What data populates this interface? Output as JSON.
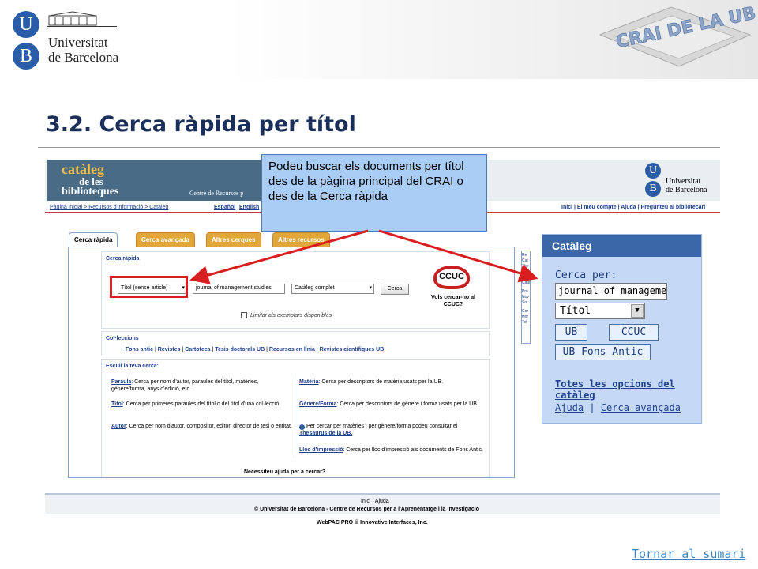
{
  "header": {
    "ub_letter_u": "U",
    "ub_letter_b": "B",
    "ub_name_line1": "Universitat",
    "ub_name_line2": "de Barcelona",
    "crai_logo_text": "CRAI DE LA UB"
  },
  "slide": {
    "title": "3.2. Cerca ràpida per títol",
    "back_link": "Tornar al sumari"
  },
  "callout": {
    "text": "Podeu buscar els documents per títol des de la pàgina principal del CRAI o des de la Cerca ràpida"
  },
  "catalog": {
    "banner_line1": "catàleg",
    "banner_line2": "de les",
    "banner_line3": "biblioteques",
    "banner_sub": "Centre de Recursos p",
    "ub_line1": "Universitat",
    "ub_line2": "de Barcelona",
    "breadcrumb": "Pàgina inicial > Recursos d'informació > Catàleg",
    "lang_es": "Español",
    "lang_en": "English",
    "top_links": "Inici | El meu compte | Ajuda | Pregunteu al bibliotecari",
    "tabs": [
      "Cerca ràpida",
      "Cerca avançada",
      "Altres cerques",
      "Altres recursos"
    ],
    "quick_search_heading": "Cerca ràpida",
    "field_select": "Títol (sense article)",
    "query_value": "journal of management studies",
    "scope_select": "Catàleg complet",
    "search_button": "Cerca",
    "ccuc_logo": "CCUC",
    "ccuc_prompt": "Vols cercar-ho al CCUC?",
    "limit_label": "Limitar als exemplars disponibles",
    "collections_heading": "Col·leccions",
    "collections_links": [
      "Fons antic",
      "Revistes",
      "Cartoteca",
      "Tesis doctorals UB",
      "Recursos en línia",
      "Revistes científiques UB"
    ],
    "choose_heading": "Escull la teva cerca:",
    "options_left": [
      {
        "term": "Paraula",
        "desc": ": Cerca per nom d'autor, paraules del títol, matèries, gènere/forma, anys d'edició, etc."
      },
      {
        "term": "Títol",
        "desc": ": Cerca per primeres paraules del títol o del títol d'una col·lecció."
      },
      {
        "term": "Autor",
        "desc": ": Cerca per nom d'autor, compositor, editor, director de tesi o entitat."
      }
    ],
    "options_right": [
      {
        "term": "Matèria",
        "desc": ": Cerca per descriptors de matèria usats per la UB."
      },
      {
        "term": "Gènere/Forma",
        "desc": ": Cerca per descriptors de gènere i forma usats per la UB."
      },
      {
        "term": "",
        "desc": "Per cercar per matèries i per gènere/forma podeu consultar el ",
        "link": "Thesaurus de la UB."
      },
      {
        "term": "Lloc d'impressió",
        "desc": ": Cerca per lloc d'impressió als documents de Fons Antic."
      }
    ],
    "help_prompt": "Necessiteu ajuda per a cercar?",
    "side_snippets": [
      "Re",
      "Cat",
      "The",
      "Altr",
      "Tele",
      "Cata",
      "Pro",
      "Nov",
      "Sol",
      "Cor",
      "Hor",
      "Tel"
    ],
    "footer_links": "Inici | Ajuda",
    "footer_copyright": "© Universitat de Barcelona - Centre de Recursos per a l'Aprenentatge i la Investigació",
    "footer_webpac": "WebPAC PRO © Innovative Interfaces, Inc."
  },
  "widget": {
    "title": "Catàleg",
    "search_label": "Cerca per:",
    "query_value": "journal of managemen",
    "type_select": "Títol",
    "buttons": [
      "UB",
      "CCUC",
      "UB Fons Antic"
    ],
    "all_options_link": "Totes les opcions del catàleg",
    "help_link": "Ajuda",
    "separator": "|",
    "advanced_link": "Cerca avançada"
  },
  "colors": {
    "title": "#1a2f5a",
    "callout_bg": "#a9cdf4",
    "arrow_red": "#d81e1e",
    "widget_bg": "#c6d9f4",
    "tab_orange": "#e3a63a"
  }
}
